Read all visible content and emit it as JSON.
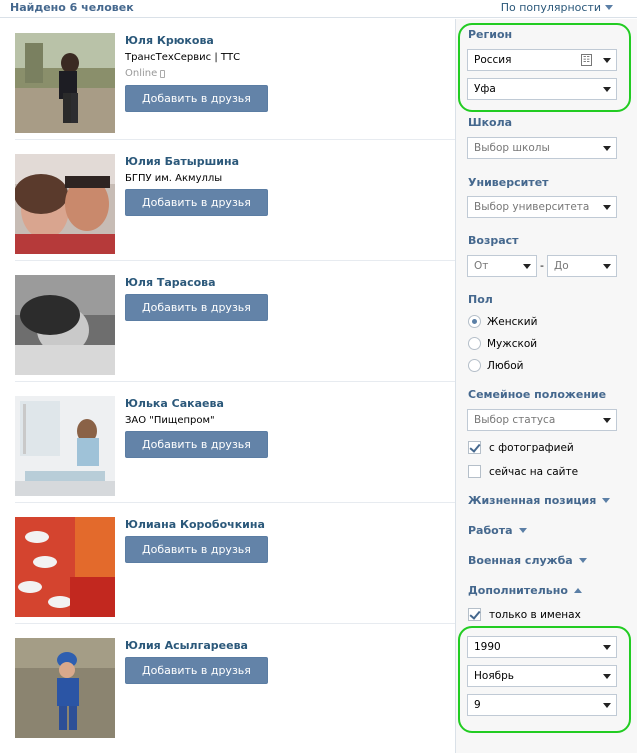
{
  "header": {
    "found": "Найдено 6 человек",
    "sort": "По популярности"
  },
  "people": [
    {
      "name": "Юля Крюкова",
      "work": "ТрансТехСервис | ТТС",
      "online": "Online",
      "button": "Добавить в друзья"
    },
    {
      "name": "Юлия Батыршина",
      "work": "БГПУ им. Акмуллы",
      "online": "",
      "button": "Добавить в друзья"
    },
    {
      "name": "Юля Тарасова",
      "work": "",
      "online": "",
      "button": "Добавить в друзья"
    },
    {
      "name": "Юлька Сакаева",
      "work": "ЗАО \"Пищепром\"",
      "online": "",
      "button": "Добавить в друзья"
    },
    {
      "name": "Юлиана Коробочкина",
      "work": "",
      "online": "",
      "button": "Добавить в друзья"
    },
    {
      "name": "Юлия Асылгареева",
      "work": "",
      "online": "",
      "button": "Добавить в друзья"
    }
  ],
  "filters": {
    "region": {
      "label": "Регион",
      "country": "Россия",
      "city": "Уфа"
    },
    "school": {
      "label": "Школа",
      "placeholder": "Выбор школы"
    },
    "university": {
      "label": "Университет",
      "placeholder": "Выбор университета"
    },
    "age": {
      "label": "Возраст",
      "from": "От",
      "to": "До",
      "separator": "-"
    },
    "gender": {
      "label": "Пол",
      "options": [
        "Женский",
        "Мужской",
        "Любой"
      ],
      "selected": 0
    },
    "marital": {
      "label": "Семейное положение",
      "placeholder": "Выбор статуса"
    },
    "with_photo": {
      "label": "с фотографией",
      "checked": true
    },
    "online_now": {
      "label": "сейчас на сайте",
      "checked": false
    },
    "life_position": {
      "label": "Жизненная позиция"
    },
    "work": {
      "label": "Работа"
    },
    "military": {
      "label": "Военная служба"
    },
    "additional": {
      "label": "Дополнительно",
      "names_only": "только в именах",
      "names_only_checked": true
    },
    "birth": {
      "year": "1990",
      "month": "Ноябрь",
      "day": "9"
    }
  },
  "colors": {
    "accent": "#45688e",
    "button": "#6383a8",
    "highlight": "#22cc22"
  }
}
